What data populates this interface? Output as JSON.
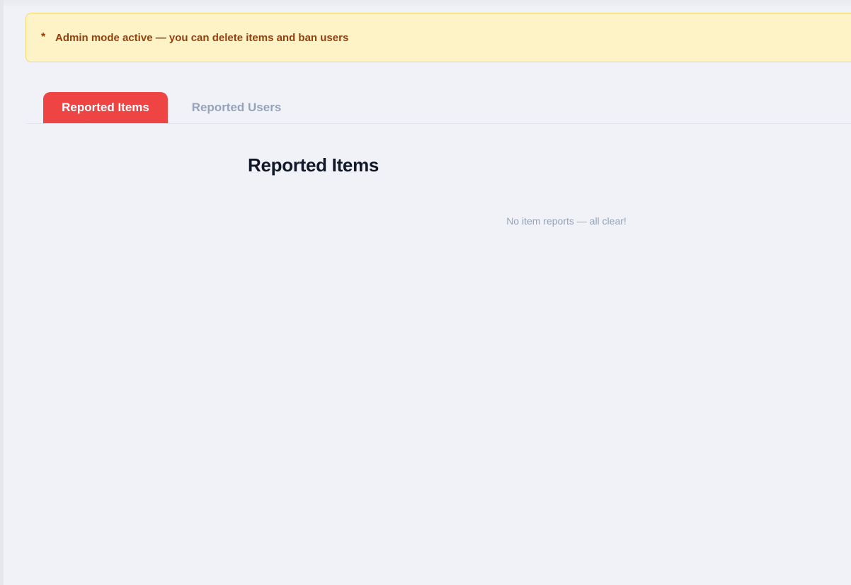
{
  "banner": {
    "icon": "*",
    "text": "Admin mode active — you can delete items and ban users"
  },
  "tabs": [
    {
      "label": "Reported Items",
      "active": true
    },
    {
      "label": "Reported Users",
      "active": false
    }
  ],
  "main": {
    "title": "Reported Items",
    "empty_message": "No item reports — all clear!"
  },
  "colors": {
    "accent": "#ef4444",
    "banner_bg": "#fef3c7",
    "banner_text": "#92400e",
    "muted_text": "#94a3b8"
  }
}
